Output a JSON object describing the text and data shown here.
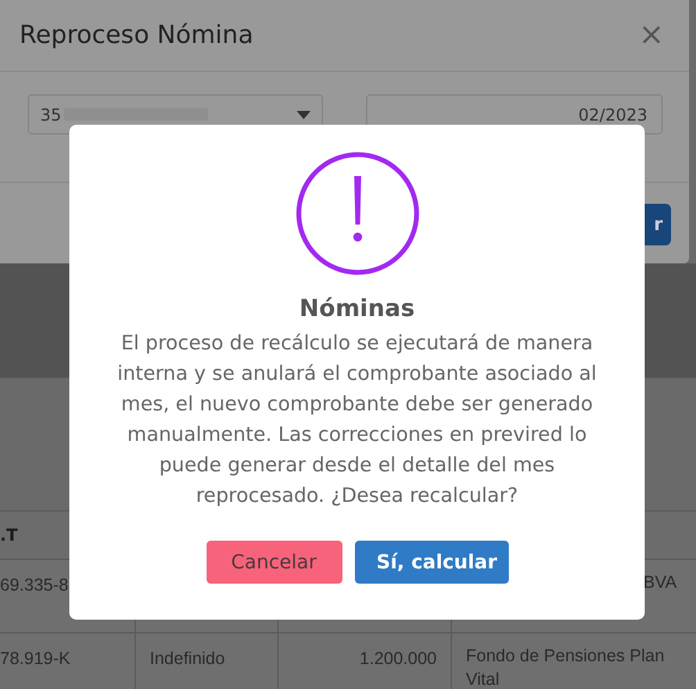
{
  "base_modal": {
    "title": "Reproceso Nómina",
    "close": "×",
    "select_value": "35",
    "date_value": "02/2023",
    "button_label": "r"
  },
  "table": {
    "header": [
      ".T"
    ],
    "rows": [
      [
        "69.335-8",
        "",
        "",
        "BVA"
      ],
      [
        "78.919-K",
        "Indefinido",
        "1.200.000",
        "Fondo de Pensiones Plan Vital"
      ]
    ]
  },
  "alert": {
    "title": "Nóminas",
    "message": "El proceso de recálculo se ejecutará de manera interna y se anulará el comprobante asociado al mes, el nuevo comprobante debe ser generado manualmente. Las correcciones en previred lo puede generar desde el detalle del mes reprocesado. ¿Desea recalcular?",
    "buttons": [
      {
        "label": "Cancelar",
        "kind": "cancel"
      },
      {
        "label": "Sí, calcular",
        "kind": "confirm"
      }
    ]
  }
}
